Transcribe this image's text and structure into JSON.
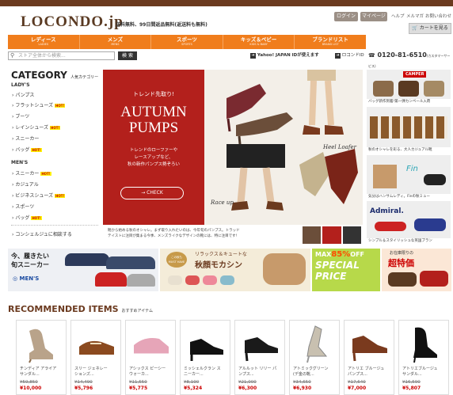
{
  "header": {
    "logo": "LOCONDO.jp",
    "tagline": "送料無料、99日間返品無料(返送料も無料)",
    "login_label": "ログイン",
    "mypage_label": "マイページ",
    "help_label": "ヘルプ",
    "mailmag_label": "メルマガ",
    "contact_label": "お問い合わせ",
    "cart_label": "カートを見る"
  },
  "nav": {
    "items": [
      {
        "jp": "レディース",
        "en": "LADIES"
      },
      {
        "jp": "メンズ",
        "en": "MENS"
      },
      {
        "jp": "スポーツ",
        "en": "SPORTS"
      },
      {
        "jp": "キッズ＆ベビー",
        "en": "KIDS & BABY"
      },
      {
        "jp": "ブランドリスト",
        "en": "BRAND LIST"
      }
    ]
  },
  "search": {
    "placeholder": "ストア全体から検索...",
    "button_label": "検 索"
  },
  "account": {
    "yahoo_label": "Yahoo! JAPAN IDが使えます",
    "locondo_id_label": "ロコンドID",
    "phone": "0120-81-6510",
    "phone_note": "(カスタマーサービス)"
  },
  "sidebar": {
    "title": "CATEGORY",
    "subtitle": "人気カテゴリー",
    "ladies_heading": "LADY'S",
    "ladies": [
      {
        "label": "パンプス",
        "hot": false
      },
      {
        "label": "フラットシューズ",
        "hot": true
      },
      {
        "label": "ブーツ",
        "hot": false
      },
      {
        "label": "レインシューズ",
        "hot": true
      },
      {
        "label": "スニーカー",
        "hot": false
      },
      {
        "label": "バッグ",
        "hot": true
      }
    ],
    "mens_heading": "MEN'S",
    "mens": [
      {
        "label": "スニーカー",
        "hot": true
      },
      {
        "label": "カジュアル",
        "hot": false
      },
      {
        "label": "ビジネスシューズ",
        "hot": true
      },
      {
        "label": "スポーツ",
        "hot": false
      },
      {
        "label": "バッグ",
        "hot": true
      }
    ],
    "hot_label": "HOT!",
    "concierge_label": "コンシェルジュに相談する"
  },
  "hero": {
    "kicker": "トレンド先取り!",
    "title_line1": "AUTUMN",
    "title_line2": "PUMPS",
    "body": "トレンドのローファーや\nレースアップなど、\n秋の新作パンプス勢ぞろい",
    "cta": "→ CHECK",
    "script1": "Heel Loafer",
    "script2": "Race up",
    "footer_text": "靴から始める秋のオシャレ。まず取り入れたいのは、今年旬のパンプス。トラッド\nテイストに注目が集まる今季、メンズライクなデザインの靴には、特に注目です!"
  },
  "right_panels": [
    {
      "brand": "CAMPER",
      "caption": "バッグ新作到着!第一弾カンペール入荷"
    },
    {
      "brand": "",
      "caption": "秋のオシャレを彩る、大人カジュアル靴"
    },
    {
      "brand": "Fin",
      "caption": "気分はハンサムレディ。Finの秋ミュー"
    },
    {
      "brand": "Admiral.",
      "caption": "シンプル＆スタイリッシュな英国ブラン"
    }
  ],
  "banners": [
    {
      "line1": "今、履きたい",
      "line2": "旬スニーカー",
      "tag": "MEN'S"
    },
    {
      "badge1": "この秋も",
      "badge2": "MUST HAVE",
      "line1": "リラックス＆キュートな",
      "line2": "秋顔モカシン"
    },
    {
      "prefix": "MAX",
      "pct": "85%",
      "off": "OFF",
      "line1": "SPECIAL",
      "line2": "PRICE"
    },
    {
      "line1": "お在庫限りの",
      "line2": "超特価"
    }
  ],
  "recommended": {
    "title": "RECOMMENDED ITEMS",
    "subtitle": "おすすめアイテム",
    "items": [
      {
        "name": "チンディア アライア\nサンダル...",
        "old": "¥59,850",
        "new": "¥10,000"
      },
      {
        "name": "スリー ジェネレー\nションズ...",
        "old": "¥14,490",
        "new": "¥5,796"
      },
      {
        "name": "アシックス ピーシー\nウォーカ...",
        "old": "¥11,550",
        "new": "¥5,775"
      },
      {
        "name": "ミッシェルクラン ス\nニーカー...",
        "old": "¥8,190",
        "new": "¥5,324"
      },
      {
        "name": "アルルット リリー パ\nンプス...",
        "old": "¥21,000",
        "new": "¥6,300"
      },
      {
        "name": "アトミックグリーン\n(デ金の靴...",
        "old": "¥34,650",
        "new": "¥6,930"
      },
      {
        "name": "アトリエ ブルージュ\nパンプス...",
        "old": "¥17,640",
        "new": "¥7,000"
      },
      {
        "name": "アトリエブルージュ\nサンダル...",
        "old": "¥16,590",
        "new": "¥5,807"
      }
    ]
  },
  "colors": {
    "brand_brown": "#6b3a1f",
    "nav_orange": "#f07d1c",
    "hero_red": "#b3201c",
    "price_red": "#cc0000"
  }
}
